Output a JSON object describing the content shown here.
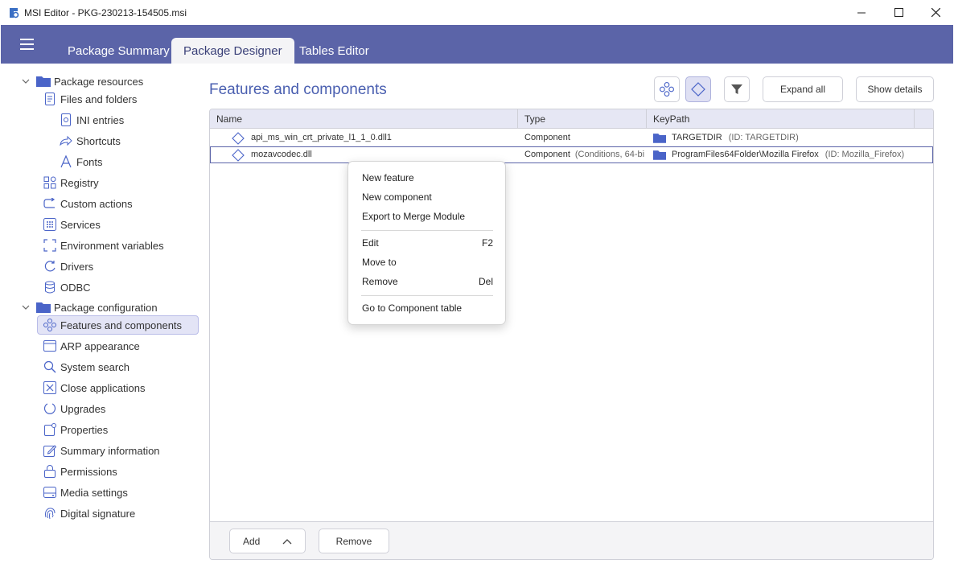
{
  "window": {
    "title": "MSI Editor - PKG-230213-154505.msi",
    "accent": "#5b64a8"
  },
  "tabs": [
    {
      "label": "Package Summary"
    },
    {
      "label": "Package Designer",
      "active": true
    },
    {
      "label": "Tables Editor"
    }
  ],
  "sidebar": {
    "groups": [
      {
        "label": "Package resources"
      },
      {
        "label": "Package configuration"
      }
    ],
    "items": [
      {
        "label": "Files and folders",
        "icon": "file-icon"
      },
      {
        "label": "INI entries",
        "icon": "ini-file-icon"
      },
      {
        "label": "Shortcuts",
        "icon": "shortcut-icon"
      },
      {
        "label": "Fonts",
        "icon": "font-icon"
      },
      {
        "label": "Registry",
        "icon": "registry-icon"
      },
      {
        "label": "Custom actions",
        "icon": "custom-action-icon"
      },
      {
        "label": "Services",
        "icon": "services-icon"
      },
      {
        "label": "Environment variables",
        "icon": "environment-icon"
      },
      {
        "label": "Drivers",
        "icon": "drivers-icon"
      },
      {
        "label": "ODBC",
        "icon": "database-icon"
      },
      {
        "label": "Features and components",
        "icon": "features-icon",
        "selected": true
      },
      {
        "label": "ARP appearance",
        "icon": "window-icon"
      },
      {
        "label": "System search",
        "icon": "search-icon"
      },
      {
        "label": "Close applications",
        "icon": "close-box-icon"
      },
      {
        "label": "Upgrades",
        "icon": "upgrade-icon"
      },
      {
        "label": "Properties",
        "icon": "properties-icon"
      },
      {
        "label": "Summary information",
        "icon": "edit-icon"
      },
      {
        "label": "Permissions",
        "icon": "lock-icon"
      },
      {
        "label": "Media settings",
        "icon": "media-icon"
      },
      {
        "label": "Digital signature",
        "icon": "fingerprint-icon"
      }
    ]
  },
  "main": {
    "title": "Features and components",
    "toolbar": {
      "expand_all": "Expand all",
      "show_details": "Show details"
    },
    "columns": [
      "Name",
      "Type",
      "KeyPath"
    ],
    "rows": [
      {
        "name": "api_ms_win_crt_private_l1_1_0.dll1",
        "type": "Component",
        "type_extra": "",
        "keypath": "TARGETDIR",
        "keypath_id": "(ID: TARGETDIR)"
      },
      {
        "name": "mozavcodec.dll",
        "type": "Component",
        "type_extra": "(Conditions, 64-bi",
        "keypath": "ProgramFiles64Folder\\Mozilla Firefox",
        "keypath_id": "(ID: Mozilla_Firefox)",
        "selected": true
      }
    ],
    "footer": {
      "add": "Add",
      "remove": "Remove"
    }
  },
  "context_menu": {
    "items": [
      {
        "label": "New feature",
        "shortcut": ""
      },
      {
        "label": "New component",
        "shortcut": ""
      },
      {
        "label": "Export to Merge Module",
        "shortcut": ""
      },
      {
        "label": "Edit",
        "shortcut": "F2"
      },
      {
        "label": "Move to",
        "shortcut": ""
      },
      {
        "label": "Remove",
        "shortcut": "Del"
      },
      {
        "label": "Go to Component table",
        "shortcut": ""
      }
    ]
  }
}
